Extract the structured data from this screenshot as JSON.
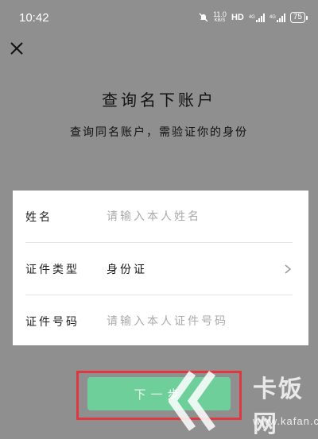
{
  "status_bar": {
    "time": "10:42",
    "net_speed_value": "11.0",
    "net_speed_unit": "KB/S",
    "hd_label": "HD",
    "network_1": "4G",
    "network_2": "4G",
    "battery": "75",
    "icons": [
      "mute-bell-icon",
      "hd-icon",
      "signal-icon",
      "signal-icon",
      "battery-icon"
    ]
  },
  "header": {
    "close_icon": "close-icon",
    "title": "查询名下账户",
    "subtitle": "查询同名账户，需验证你的身份"
  },
  "form": {
    "name": {
      "label": "姓名",
      "placeholder": "请输入本人姓名"
    },
    "id_type": {
      "label": "证件类型",
      "value": "身份证",
      "icon": "chevron-right-icon"
    },
    "id_number": {
      "label": "证件号码",
      "placeholder": "请输入本人证件号码"
    }
  },
  "actions": {
    "next_label": "下一步"
  },
  "watermark": {
    "brand": "卡饭网",
    "url": "www.kafan.cn"
  },
  "colors": {
    "background": "#8f8f8f",
    "button": "#6fcf9a",
    "highlight": "#e0383e"
  }
}
